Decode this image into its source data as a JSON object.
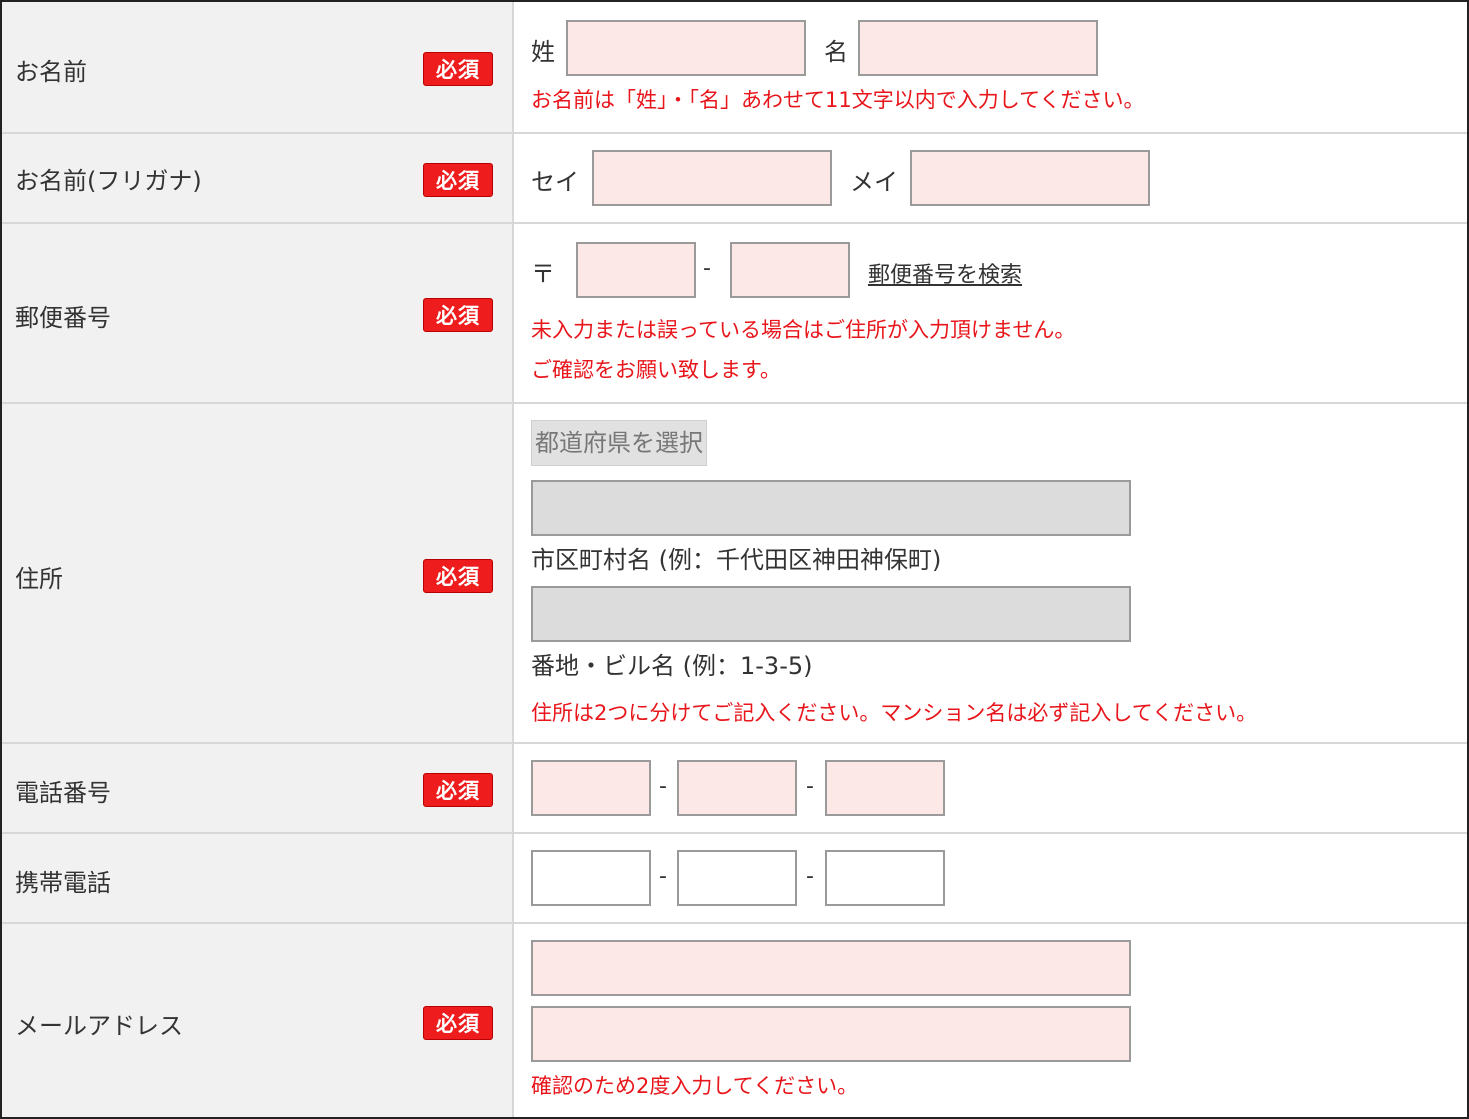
{
  "required_badge": "必須",
  "name": {
    "label": "お名前",
    "sei_label": "姓",
    "mei_label": "名",
    "sei_value": "",
    "mei_value": "",
    "note": "お名前は「姓」・「名」あわせて11文字以内で入力してください。"
  },
  "kana": {
    "label": "お名前(フリガナ)",
    "sei_label": "セイ",
    "mei_label": "メイ",
    "sei_value": "",
    "mei_value": ""
  },
  "postal": {
    "label": "郵便番号",
    "mark": "〒",
    "dash": "-",
    "part1": "",
    "part2": "",
    "search_link": "郵便番号を検索",
    "note1": "未入力または誤っている場合はご住所が入力頂けません。",
    "note2": "ご確認をお願い致します。"
  },
  "address": {
    "label": "住所",
    "prefecture_select": "都道府県を選択",
    "city_value": "",
    "city_hint": "市区町村名 (例：千代田区神田神保町)",
    "street_value": "",
    "street_hint": "番地・ビル名 (例：1-3-5)",
    "note": "住所は2つに分けてご記入ください。マンション名は必ず記入してください。"
  },
  "phone": {
    "label": "電話番号",
    "dash": "-",
    "part1": "",
    "part2": "",
    "part3": ""
  },
  "mobile": {
    "label": "携帯電話",
    "dash": "-",
    "part1": "",
    "part2": "",
    "part3": ""
  },
  "email": {
    "label": "メールアドレス",
    "value": "",
    "confirm_value": "",
    "note": "確認のため2度入力してください。"
  },
  "colors": {
    "required_bg": "#ee1c1c",
    "note_text": "#e8161b",
    "required_input_bg": "#fde8e8",
    "label_bg": "#f1f1f1"
  }
}
